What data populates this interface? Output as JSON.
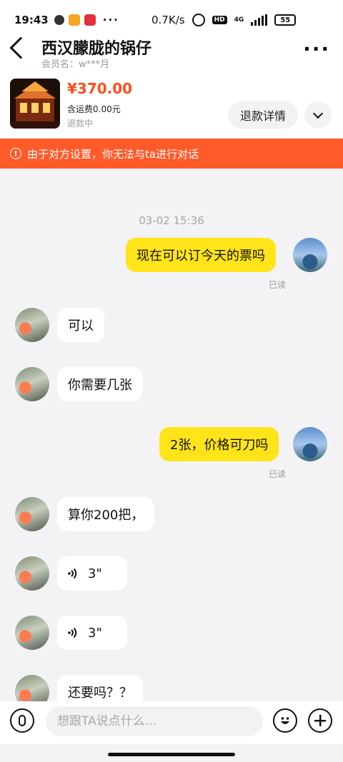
{
  "status_bar": {
    "time": "19:43",
    "more": "···",
    "speed": "0.7K/s",
    "hd": "HD",
    "network": "4G",
    "battery": "55"
  },
  "header": {
    "title": "西汉朦胧的锅仔",
    "subtitle": "会员名：w***月"
  },
  "product": {
    "price": "¥370.00",
    "shipping": "含运费0.00元",
    "status": "退款中",
    "refund_button": "退款详情"
  },
  "banner": {
    "icon": "!",
    "text": "由于对方设置，你无法与ta进行对话"
  },
  "chat": {
    "timestamp": "03-02 15:36",
    "messages": [
      {
        "from": "me",
        "text": "现在可以订今天的票吗",
        "read": "已读"
      },
      {
        "from": "other",
        "text": "可以"
      },
      {
        "from": "other",
        "text": "你需要几张"
      },
      {
        "from": "me",
        "text": "2张，价格可刀吗",
        "read": "已读"
      },
      {
        "from": "other",
        "text": "算你200把，"
      },
      {
        "from": "other",
        "type": "voice",
        "text": "3\""
      },
      {
        "from": "other",
        "type": "voice",
        "text": "3\""
      },
      {
        "from": "other",
        "text": "还要吗？？"
      }
    ]
  },
  "input": {
    "placeholder": "想跟TA说点什么..."
  },
  "icons": {
    "back": "back-arrow-icon",
    "more": "more-dots-icon",
    "expand": "chevron-down-icon",
    "warning": "warning-circle-icon",
    "voice": "voice-wave-icon",
    "mic": "microphone-icon",
    "emoji": "emoji-icon",
    "plus": "plus-icon"
  },
  "colors": {
    "accent_price": "#ff4e1a",
    "banner": "#ff5a2a",
    "my_bubble": "#ffe41a"
  }
}
